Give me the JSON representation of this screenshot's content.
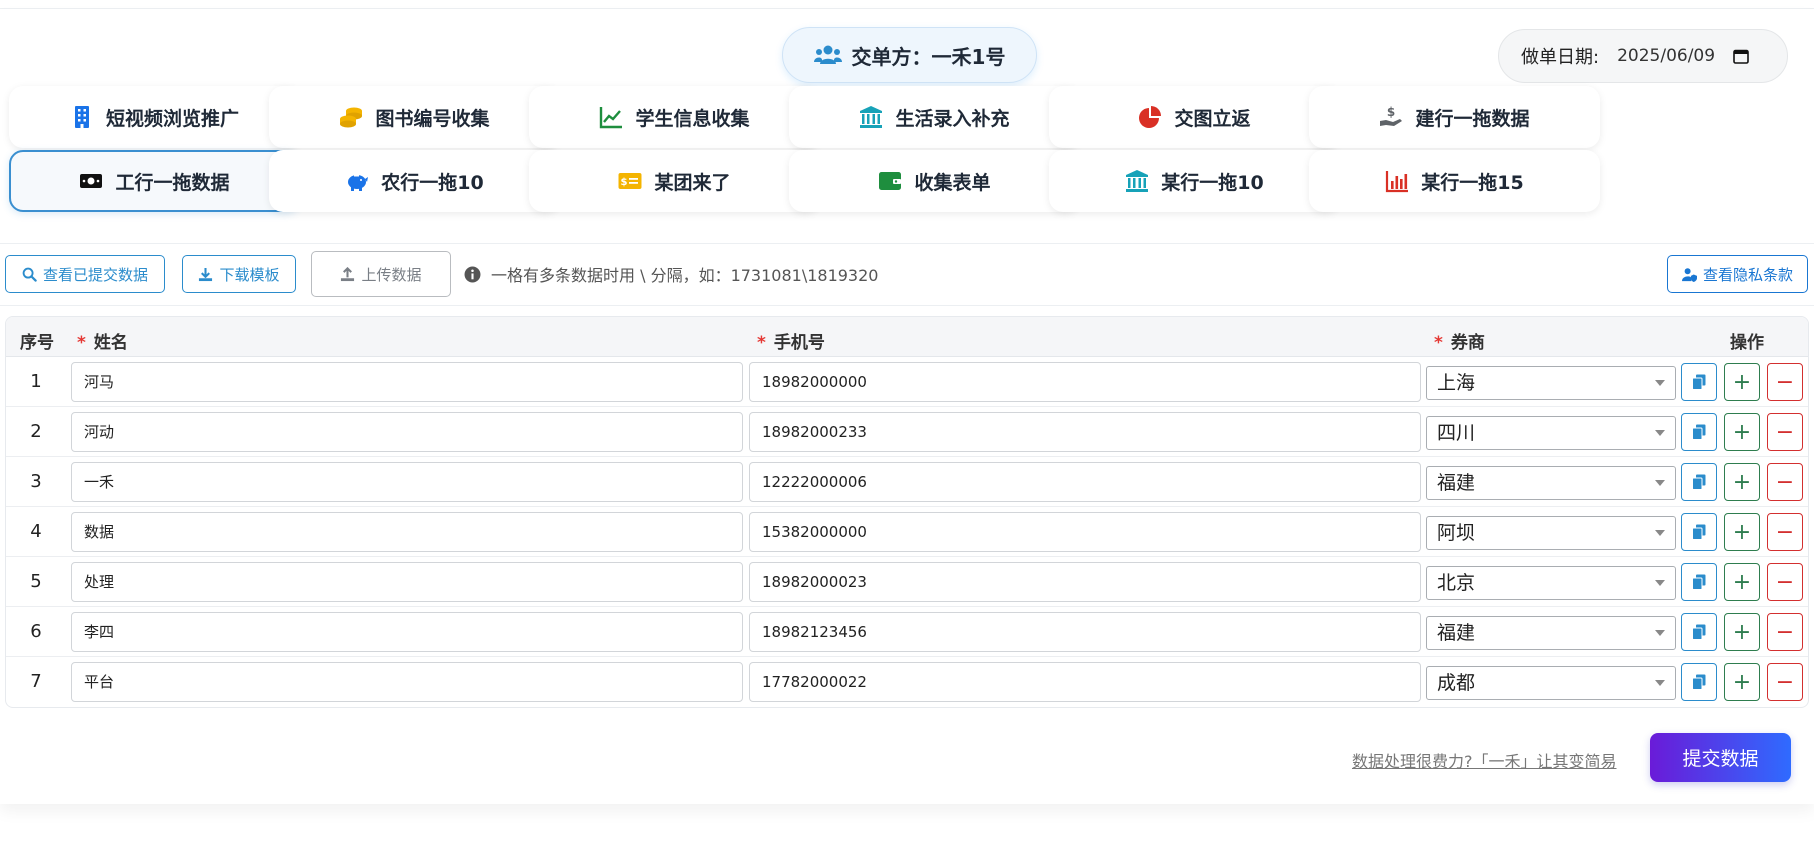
{
  "header": {
    "party_label": "交单方：一禾1号",
    "date_label": "做单日期:",
    "date_value": "2025/06/09"
  },
  "tabs": [
    {
      "label": "短视频浏览推广",
      "icon": "building-icon",
      "color": "#1a73e8"
    },
    {
      "label": "图书编号收集",
      "icon": "coins-icon",
      "color": "#f4b400"
    },
    {
      "label": "学生信息收集",
      "icon": "line-chart-icon",
      "color": "#1e8e3e"
    },
    {
      "label": "生活录入补充",
      "icon": "bank-icon",
      "color": "#17a2b8"
    },
    {
      "label": "交图立返",
      "icon": "pie-chart-icon",
      "color": "#d93025"
    },
    {
      "label": "建行一拖数据",
      "icon": "hand-dollar-icon",
      "color": "#5f6368"
    },
    {
      "label": "工行一拖数据",
      "icon": "money-bill-icon",
      "color": "#111111",
      "active": true
    },
    {
      "label": "农行一拖10",
      "icon": "piggy-bank-icon",
      "color": "#1a73e8"
    },
    {
      "label": "某团来了",
      "icon": "money-check-icon",
      "color": "#f4b400"
    },
    {
      "label": "收集表单",
      "icon": "wallet-icon",
      "color": "#1e8e3e"
    },
    {
      "label": "某行一拖10",
      "icon": "bank-icon",
      "color": "#17a2b8"
    },
    {
      "label": "某行一拖15",
      "icon": "bar-chart-icon",
      "color": "#d93025"
    }
  ],
  "toolbar": {
    "view_submitted": "查看已提交数据",
    "download_template": "下载模板",
    "upload_data": "上传数据",
    "hint": "一格有多条数据时用 \\ 分隔，如：1731081\\1819320",
    "privacy": "查看隐私条款"
  },
  "table": {
    "headers": {
      "index": "序号",
      "name": "姓名",
      "phone": "手机号",
      "broker": "券商",
      "actions": "操作"
    },
    "required_mark": "*",
    "rows": [
      {
        "index": "1",
        "name": "河马",
        "phone": "18982000000",
        "broker": "上海"
      },
      {
        "index": "2",
        "name": "河动",
        "phone": "18982000233",
        "broker": "四川"
      },
      {
        "index": "3",
        "name": "一禾",
        "phone": "12222000006",
        "broker": "福建"
      },
      {
        "index": "4",
        "name": "数据",
        "phone": "15382000000",
        "broker": "阿坝"
      },
      {
        "index": "5",
        "name": "处理",
        "phone": "18982000023",
        "broker": "北京"
      },
      {
        "index": "6",
        "name": "李四",
        "phone": "18982123456",
        "broker": "福建"
      },
      {
        "index": "7",
        "name": "平台",
        "phone": "17782000022",
        "broker": "成都"
      }
    ],
    "add_symbol": "+",
    "remove_symbol": "−"
  },
  "footer": {
    "tagline": "数据处理很费力?「一禾」让其变简易",
    "submit": "提交数据"
  },
  "colors": {
    "accent_blue": "#2b8ccc",
    "add_green": "#2e7d4f",
    "remove_red": "#d32f2f",
    "submit_gradient_start": "#6a1bd8",
    "submit_gradient_end": "#2f6bff"
  }
}
